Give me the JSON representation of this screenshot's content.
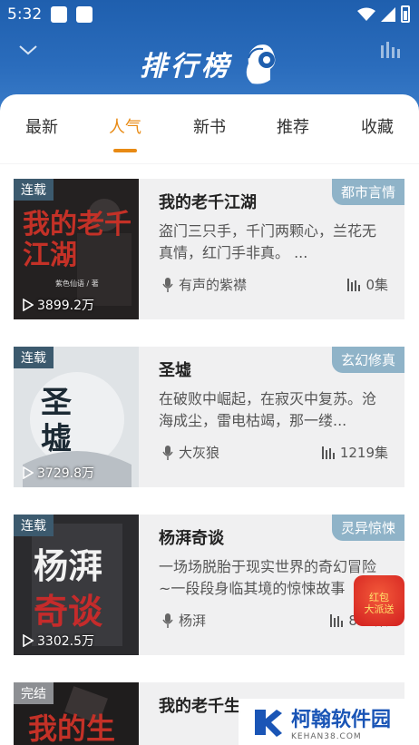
{
  "status_bar": {
    "time": "5:32"
  },
  "header": {
    "title": "排行榜"
  },
  "tabs": [
    {
      "label": "最新",
      "active": false
    },
    {
      "label": "人气",
      "active": true
    },
    {
      "label": "新书",
      "active": false
    },
    {
      "label": "推荐",
      "active": false
    },
    {
      "label": "收藏",
      "active": false
    }
  ],
  "books": [
    {
      "status": "连载",
      "plays": "3899.2万",
      "title": "我的老千江湖",
      "genre": "都市言情",
      "description": "盗门三只手，千门两颗心，兰花无真情，红门手非真。 ...",
      "author": "有声的紫襟",
      "episodes": "0集"
    },
    {
      "status": "连载",
      "plays": "3729.8万",
      "title": "圣墟",
      "genre": "玄幻修真",
      "description": "在破败中崛起，在寂灭中复苏。沧海成尘，雷电枯竭，那一缕...",
      "author": "大灰狼",
      "episodes": "1219集"
    },
    {
      "status": "连载",
      "plays": "3302.5万",
      "title": "杨湃奇谈",
      "genre": "灵异惊悚",
      "description": "一场场脱胎于现实世界的奇幻冒险~一段段身临其境的惊悚故事",
      "author": "杨湃",
      "episodes": "827集"
    },
    {
      "status": "完结",
      "title": "我的老千生"
    }
  ],
  "cover_texts": {
    "book1": "我的老千江湖",
    "book1_author": "紫色仙语 / 著",
    "book2": "圣墟",
    "book3_top": "杨湃",
    "book3_bottom": "奇谈",
    "book4": "我的生"
  },
  "promo": {
    "line1": "红包",
    "line2": "大派送"
  },
  "watermark": {
    "name": "柯翰软件园",
    "url": "KEHAN38.COM"
  }
}
